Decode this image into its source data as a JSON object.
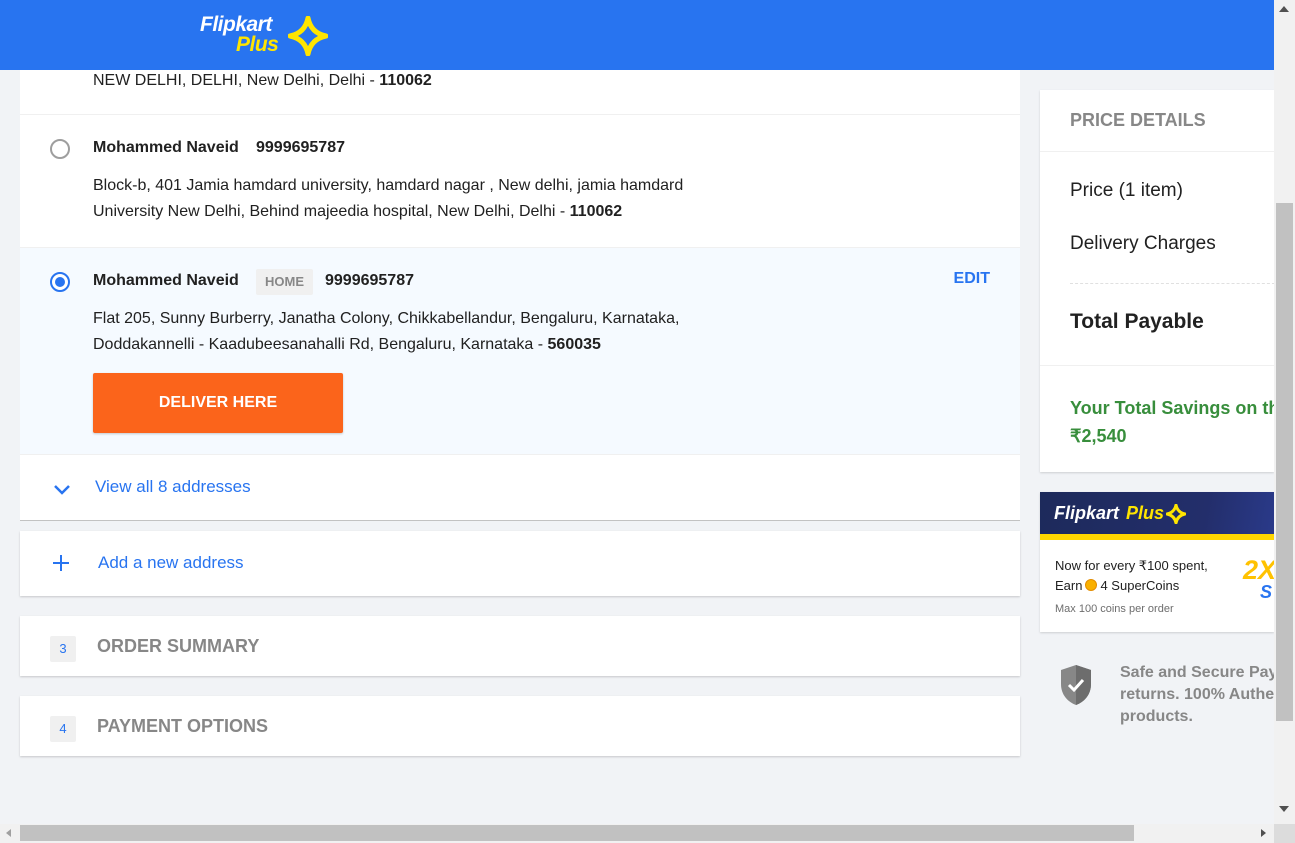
{
  "header": {
    "logo_line1": "Flipkart",
    "logo_line2": "Plus",
    "logo_icon": "plus-star-icon",
    "colors": {
      "bar": "#2874f0",
      "logo_accent": "#ffe500"
    }
  },
  "addresses": {
    "partial_top": {
      "text": "NEW DELHI, DELHI, New Delhi, Delhi - ",
      "pincode": "110062"
    },
    "items": [
      {
        "name": "Mohammed Naveid",
        "tag": "",
        "phone": "9999695787",
        "line1": "Block-b, 401 Jamia hamdard university, hamdard nagar , New delhi, jamia hamdard",
        "line2": "University New Delhi, Behind majeedia hospital, New Delhi, Delhi - ",
        "pincode": "110062",
        "selected": false
      },
      {
        "name": "Mohammed Naveid",
        "tag": "HOME",
        "phone": "9999695787",
        "line1": "Flat 205, Sunny Burberry, Janatha Colony, Chikkabellandur, Bengaluru, Karnataka,",
        "line2": "Doddakannelli - Kaadubeesanahalli Rd, Bengaluru, Karnataka - ",
        "pincode": "560035",
        "selected": true,
        "edit_label": "EDIT",
        "deliver_label": "DELIVER HERE"
      }
    ],
    "view_all_label": "View all 8 addresses",
    "add_new_label": "Add a new address"
  },
  "steps": [
    {
      "number": "3",
      "title": "ORDER SUMMARY"
    },
    {
      "number": "4",
      "title": "PAYMENT OPTIONS"
    }
  ],
  "price_details": {
    "title": "PRICE DETAILS",
    "rows": [
      "Price (1 item)",
      "Delivery Charges"
    ],
    "total_label": "Total Payable",
    "savings_label": "Your Total Savings on th",
    "savings_value": "₹2,540"
  },
  "plus_banner": {
    "logo_line1": "Flipkart",
    "logo_line2": "Plus",
    "line1": "Now for every ₹100 spent,",
    "line2_prefix": "Earn",
    "line2_suffix": "4 SuperCoins",
    "line3": "Max 100 coins per order",
    "big_text": "2X",
    "big_text2": "S"
  },
  "secure": {
    "icon": "shield-check-icon",
    "lines": [
      "Safe and Secure Pay",
      "returns. 100% Authe",
      "products."
    ]
  },
  "colors": {
    "accent": "#2874f0",
    "cta": "#fb641b",
    "savings": "#388e3c",
    "page_bg": "#f1f3f6"
  }
}
